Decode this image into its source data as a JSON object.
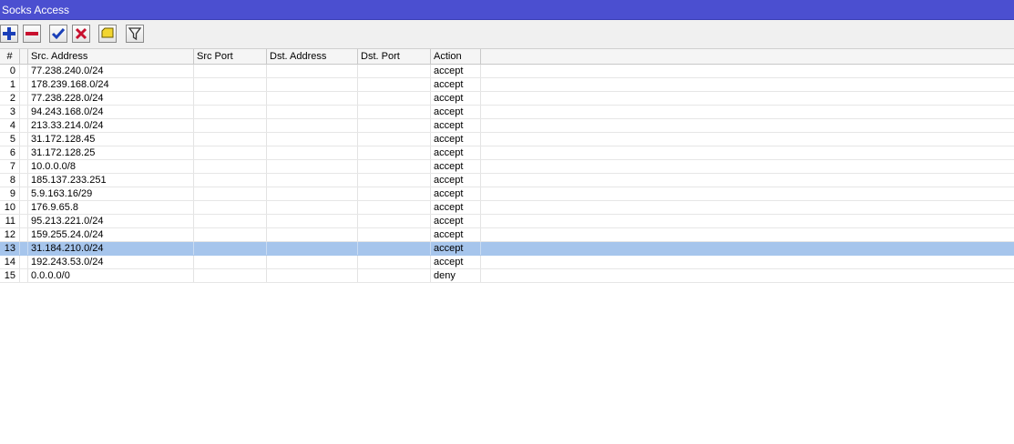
{
  "window": {
    "title": "Socks Access"
  },
  "toolbar": {
    "buttons": [
      {
        "name": "add-button",
        "icon": "plus-icon",
        "color": "#1a3fb8"
      },
      {
        "name": "remove-button",
        "icon": "minus-icon",
        "color": "#c8102e"
      },
      {
        "name": "enable-button",
        "icon": "check-icon",
        "color": "#1a3fb8"
      },
      {
        "name": "disable-button",
        "icon": "x-icon",
        "color": "#c8102e"
      },
      {
        "name": "comment-button",
        "icon": "comment-icon",
        "color": "#f2d530"
      },
      {
        "name": "filter-button",
        "icon": "filter-icon",
        "color": "#333333"
      }
    ]
  },
  "table": {
    "columns": [
      "#",
      "Src. Address",
      "Src Port",
      "Dst. Address",
      "Dst. Port",
      "Action"
    ],
    "selected_index": 13,
    "rows": [
      {
        "num": "0",
        "src_address": "77.238.240.0/24",
        "src_port": "",
        "dst_address": "",
        "dst_port": "",
        "action": "accept"
      },
      {
        "num": "1",
        "src_address": "178.239.168.0/24",
        "src_port": "",
        "dst_address": "",
        "dst_port": "",
        "action": "accept"
      },
      {
        "num": "2",
        "src_address": "77.238.228.0/24",
        "src_port": "",
        "dst_address": "",
        "dst_port": "",
        "action": "accept"
      },
      {
        "num": "3",
        "src_address": "94.243.168.0/24",
        "src_port": "",
        "dst_address": "",
        "dst_port": "",
        "action": "accept"
      },
      {
        "num": "4",
        "src_address": "213.33.214.0/24",
        "src_port": "",
        "dst_address": "",
        "dst_port": "",
        "action": "accept"
      },
      {
        "num": "5",
        "src_address": "31.172.128.45",
        "src_port": "",
        "dst_address": "",
        "dst_port": "",
        "action": "accept"
      },
      {
        "num": "6",
        "src_address": "31.172.128.25",
        "src_port": "",
        "dst_address": "",
        "dst_port": "",
        "action": "accept"
      },
      {
        "num": "7",
        "src_address": "10.0.0.0/8",
        "src_port": "",
        "dst_address": "",
        "dst_port": "",
        "action": "accept"
      },
      {
        "num": "8",
        "src_address": "185.137.233.251",
        "src_port": "",
        "dst_address": "",
        "dst_port": "",
        "action": "accept"
      },
      {
        "num": "9",
        "src_address": "5.9.163.16/29",
        "src_port": "",
        "dst_address": "",
        "dst_port": "",
        "action": "accept"
      },
      {
        "num": "10",
        "src_address": "176.9.65.8",
        "src_port": "",
        "dst_address": "",
        "dst_port": "",
        "action": "accept"
      },
      {
        "num": "11",
        "src_address": "95.213.221.0/24",
        "src_port": "",
        "dst_address": "",
        "dst_port": "",
        "action": "accept"
      },
      {
        "num": "12",
        "src_address": "159.255.24.0/24",
        "src_port": "",
        "dst_address": "",
        "dst_port": "",
        "action": "accept"
      },
      {
        "num": "13",
        "src_address": "31.184.210.0/24",
        "src_port": "",
        "dst_address": "",
        "dst_port": "",
        "action": "accept"
      },
      {
        "num": "14",
        "src_address": "192.243.53.0/24",
        "src_port": "",
        "dst_address": "",
        "dst_port": "",
        "action": "accept"
      },
      {
        "num": "15",
        "src_address": "0.0.0.0/0",
        "src_port": "",
        "dst_address": "",
        "dst_port": "",
        "action": "deny"
      }
    ]
  }
}
